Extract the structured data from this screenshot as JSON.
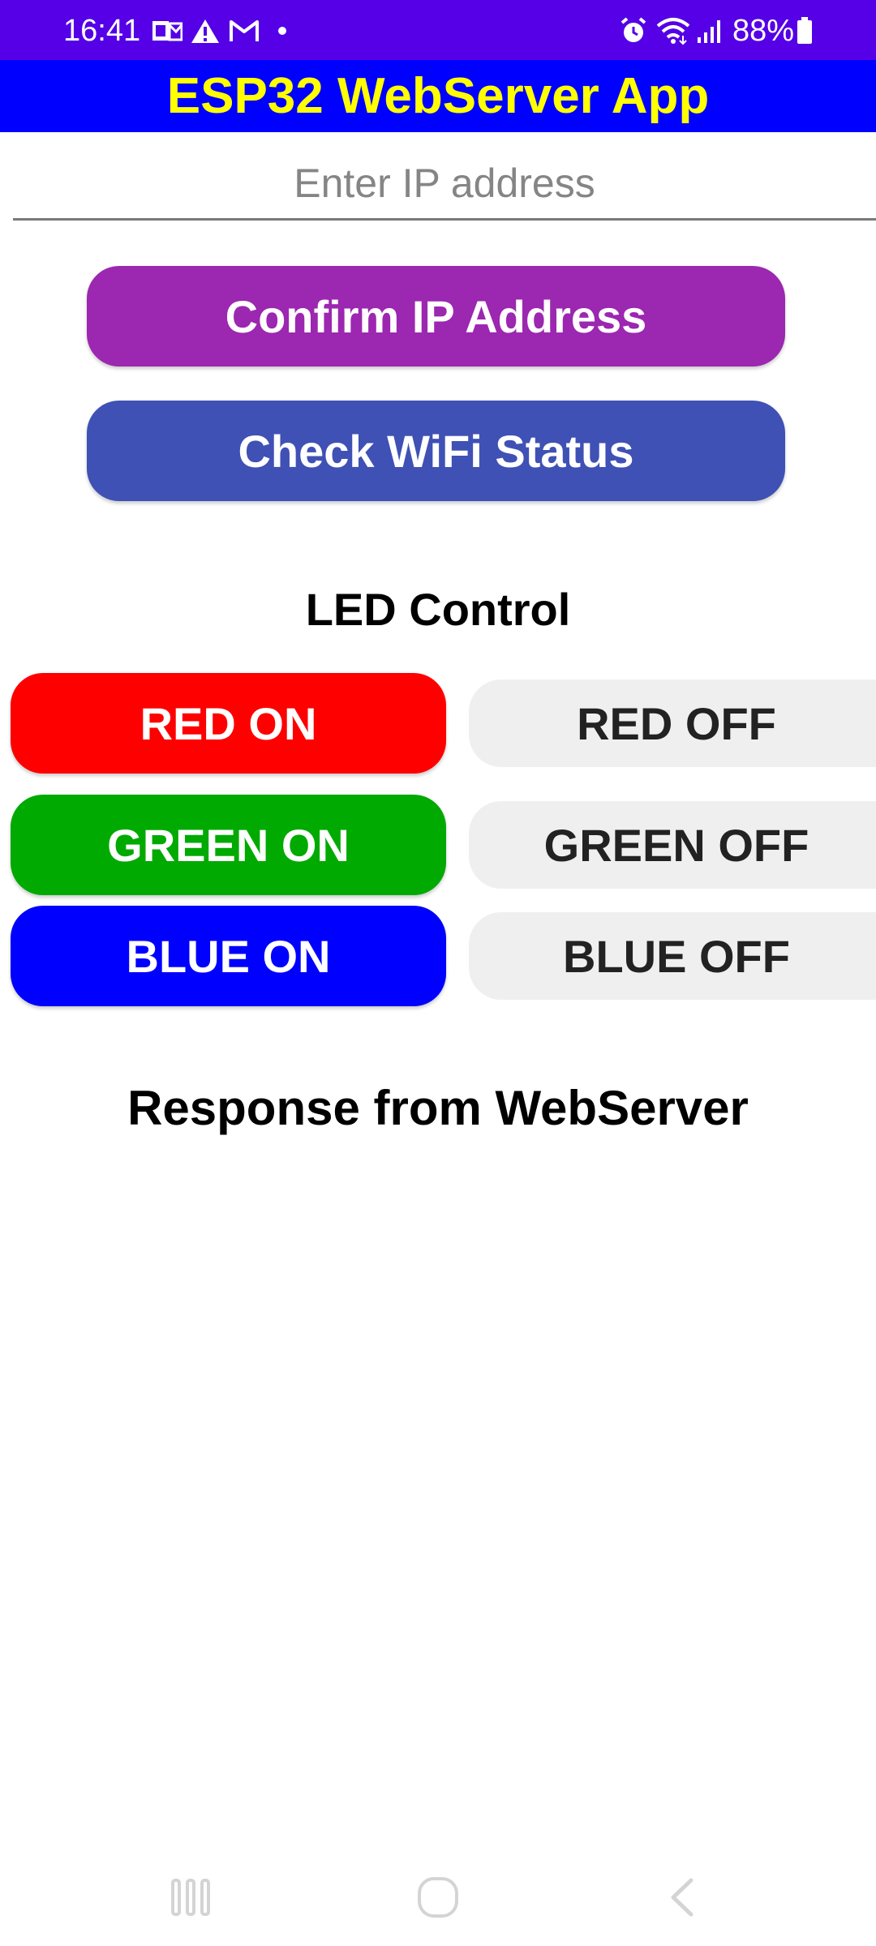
{
  "status_bar": {
    "time": "16:41",
    "battery": "88%",
    "background_color": "#5500e6",
    "icons": [
      "outlook-icon",
      "warning-icon",
      "gmail-icon",
      "notification-dot-icon",
      "alarm-icon",
      "wifi-icon",
      "signal-icon",
      "battery-icon"
    ]
  },
  "app_bar": {
    "title": "ESP32 WebServer App",
    "background_color": "#0000ff",
    "title_color": "#ffff00"
  },
  "ip_input": {
    "placeholder": "Enter IP address",
    "value": ""
  },
  "buttons": {
    "confirm_ip": "Confirm IP Address",
    "check_wifi": "Check WiFi Status"
  },
  "led_control": {
    "title": "LED Control",
    "red_on": "RED ON",
    "red_off": "RED OFF",
    "green_on": "GREEN ON",
    "green_off": "GREEN OFF",
    "blue_on": "BLUE ON",
    "blue_off": "BLUE OFF",
    "colors": {
      "red": "#ff0000",
      "green": "#00aa00",
      "blue": "#0000ff",
      "off": "#efefef"
    }
  },
  "response": {
    "title": "Response from WebServer",
    "text": ""
  },
  "nav_bar": {
    "icons": [
      "recent-apps-icon",
      "home-icon",
      "back-icon"
    ]
  }
}
